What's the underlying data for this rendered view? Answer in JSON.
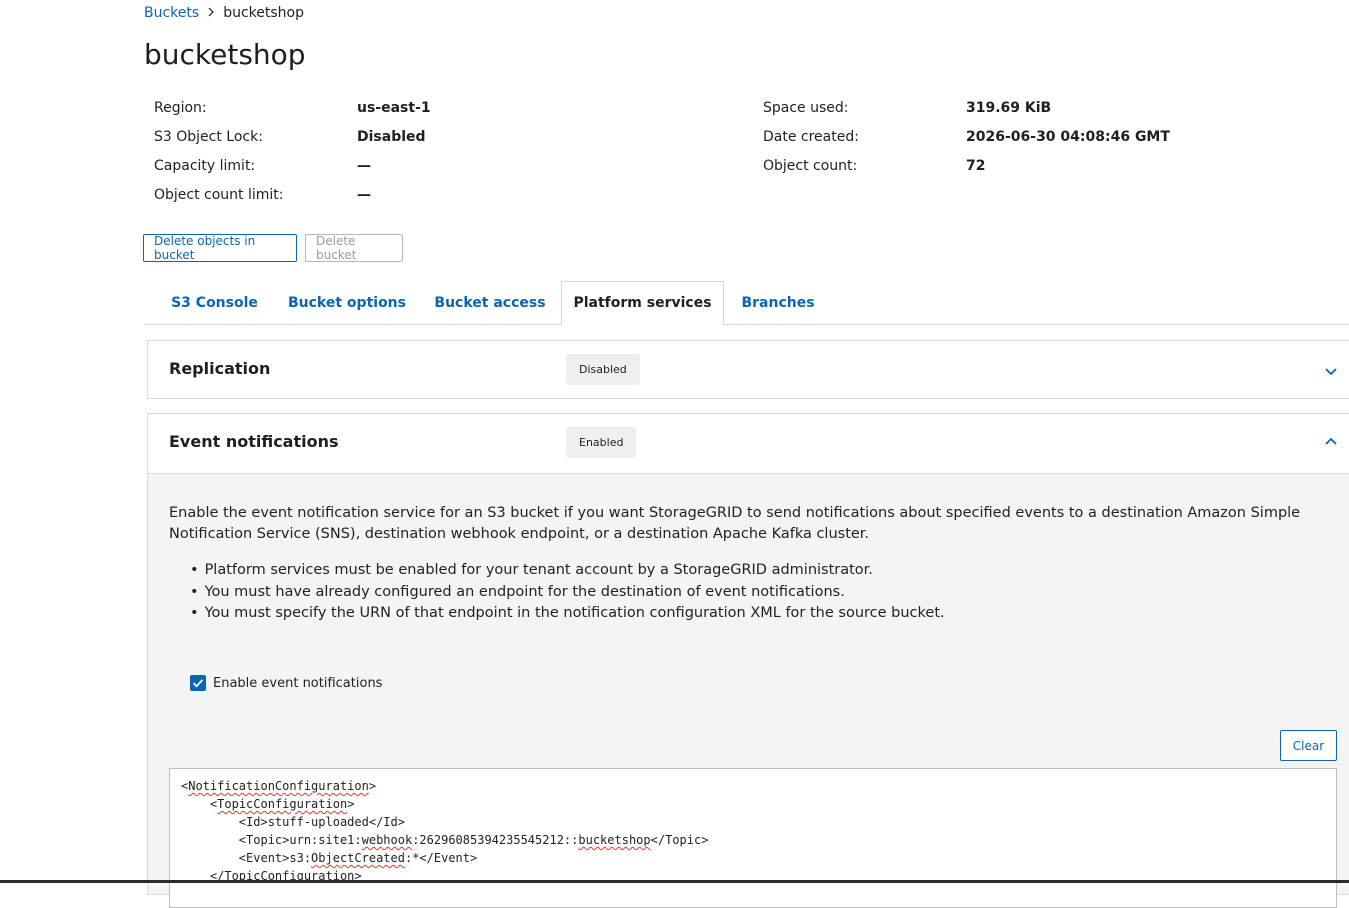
{
  "breadcrumb": {
    "parent": "Buckets",
    "current": "bucketshop"
  },
  "page_title": "bucketshop",
  "details_left": [
    {
      "label": "Region:",
      "value": "us-east-1"
    },
    {
      "label": "S3 Object Lock:",
      "value": "Disabled"
    },
    {
      "label": "Capacity limit:",
      "value": "—"
    },
    {
      "label": "Object count limit:",
      "value": "—"
    }
  ],
  "details_right": [
    {
      "label": "Space used:",
      "value": "319.69 KiB"
    },
    {
      "label": "Date created:",
      "value": "2026-06-30 04:08:46 GMT"
    },
    {
      "label": "Object count:",
      "value": "72"
    }
  ],
  "actions": {
    "delete_objects": "Delete objects in bucket",
    "delete_bucket": "Delete bucket"
  },
  "tabs": [
    "S3 Console",
    "Bucket options",
    "Bucket access",
    "Platform services",
    "Branches"
  ],
  "active_tab": "Platform services",
  "replication": {
    "title": "Replication",
    "status": "Disabled"
  },
  "events": {
    "title": "Event notifications",
    "status": "Enabled",
    "description": "Enable the event notification service for an S3 bucket if you want StorageGRID to send notifications about specified events to a destination Amazon Simple Notification Service (SNS), destination webhook endpoint, or a destination Apache Kafka cluster.",
    "bullets": [
      "Platform services must be enabled for your tenant account by a StorageGRID administrator.",
      "You must have already configured an endpoint for the destination of event notifications.",
      "You must specify the URN of that endpoint in the notification configuration XML for the source bucket."
    ],
    "checkbox_label": "Enable event notifications",
    "checkbox_checked": true,
    "clear_label": "Clear",
    "xml": {
      "l1_open": "<",
      "l1_tag": "NotificationConfiguration",
      "l1_close": ">",
      "l2_open": "<",
      "l2_tag": "TopicConfiguration",
      "l2_close": ">",
      "l3": "<Id>stuff-uploaded</Id>",
      "l4_a": "<Topic>urn:site1:",
      "l4_b": "webhook",
      "l4_c": ":26296085394235545212::",
      "l4_d": "bucketshop",
      "l4_e": "</Topic>",
      "l5_a": "<Event>s3:",
      "l5_b": "ObjectCreated",
      "l5_c": ":*</Event>",
      "l6": "</TopicConfiguration>"
    }
  },
  "colors": {
    "accent": "#0a65b5",
    "badge_bg": "#efefef",
    "panel_body_bg": "#f4f4f4"
  },
  "icons": {
    "breadcrumb_separator": "chevron-right-icon",
    "collapsed": "chevron-down-icon",
    "expanded": "chevron-up-icon",
    "check": "checkmark-icon"
  }
}
